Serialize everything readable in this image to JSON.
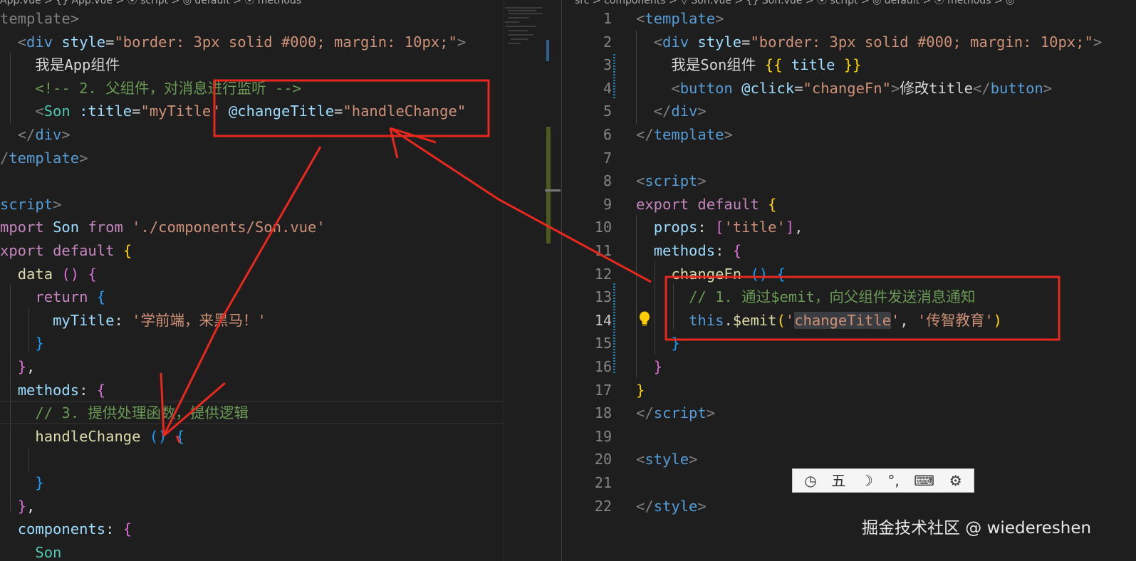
{
  "left_editor": {
    "breadcrumb": "App.vue > {} App.vue > ⦿ script > ◎ default > ⦿ methods",
    "lines": [
      [
        [
          "t-br",
          "template>"
        ]
      ],
      [
        [
          "t-txt",
          "  "
        ],
        [
          "t-br",
          "<"
        ],
        [
          "t-tag",
          "div"
        ],
        [
          "t-txt",
          " "
        ],
        [
          "t-attr",
          "style"
        ],
        [
          "t-txt",
          "="
        ],
        [
          "t-str",
          "\"border: 3px solid #000; margin: 10px;\""
        ],
        [
          "t-br",
          ">"
        ]
      ],
      [
        [
          "t-txt",
          "    我是App组件"
        ]
      ],
      [
        [
          "t-txt",
          "    "
        ],
        [
          "t-com",
          "<!-- 2. 父组件，对消息进行监听 -->"
        ]
      ],
      [
        [
          "t-txt",
          "    "
        ],
        [
          "t-br",
          "<"
        ],
        [
          "t-cls",
          "Son"
        ],
        [
          "t-txt",
          " "
        ],
        [
          "t-attr",
          ":title"
        ],
        [
          "t-txt",
          "="
        ],
        [
          "t-str",
          "\"myTitle\""
        ],
        [
          "t-txt",
          " "
        ],
        [
          "t-attr",
          "@changeTitle"
        ],
        [
          "t-txt",
          "="
        ],
        [
          "t-str",
          "\"handleChange\""
        ]
      ],
      [
        [
          "t-txt",
          "  "
        ],
        [
          "t-br",
          "</"
        ],
        [
          "t-tag",
          "div"
        ],
        [
          "t-br",
          ">"
        ]
      ],
      [
        [
          "t-br",
          "/"
        ],
        [
          "t-tag",
          "template"
        ],
        [
          "t-br",
          ">"
        ]
      ],
      [],
      [
        [
          "t-tag",
          "script"
        ],
        [
          "t-br",
          ">"
        ]
      ],
      [
        [
          "t-kw",
          "mport"
        ],
        [
          "t-txt",
          " "
        ],
        [
          "t-prop",
          "Son"
        ],
        [
          "t-txt",
          " "
        ],
        [
          "t-kw",
          "from"
        ],
        [
          "t-txt",
          " "
        ],
        [
          "t-str",
          "'./components/Son.vue'"
        ]
      ],
      [
        [
          "t-kw",
          "xport"
        ],
        [
          "t-txt",
          " "
        ],
        [
          "t-kw",
          "default"
        ],
        [
          "t-txt",
          " "
        ],
        [
          "t-y",
          "{"
        ]
      ],
      [
        [
          "t-txt",
          "  "
        ],
        [
          "t-fn",
          "data"
        ],
        [
          "t-txt",
          " "
        ],
        [
          "t-p",
          "()"
        ],
        [
          "t-txt",
          " "
        ],
        [
          "t-p",
          "{"
        ]
      ],
      [
        [
          "t-txt",
          "    "
        ],
        [
          "t-kw",
          "return"
        ],
        [
          "t-txt",
          " "
        ],
        [
          "t-b",
          "{"
        ]
      ],
      [
        [
          "t-txt",
          "      "
        ],
        [
          "t-prop",
          "myTitle"
        ],
        [
          "t-txt",
          ": "
        ],
        [
          "t-str",
          "'学前端，来黑马！'"
        ]
      ],
      [
        [
          "t-txt",
          "    "
        ],
        [
          "t-b",
          "}"
        ]
      ],
      [
        [
          "t-txt",
          "  "
        ],
        [
          "t-p",
          "}"
        ],
        [
          "t-txt",
          ","
        ]
      ],
      [
        [
          "t-txt",
          "  "
        ],
        [
          "t-prop",
          "methods"
        ],
        [
          "t-txt",
          ": "
        ],
        [
          "t-p",
          "{"
        ]
      ],
      [
        [
          "t-txt",
          "    "
        ],
        [
          "t-com",
          "// 3. 提供处理函数，提供逻辑"
        ]
      ],
      [
        [
          "t-txt",
          "    "
        ],
        [
          "t-fn",
          "handleChange"
        ],
        [
          "t-txt",
          " "
        ],
        [
          "t-b",
          "()"
        ],
        [
          "t-txt",
          " "
        ],
        [
          "t-b",
          "{"
        ]
      ],
      [],
      [
        [
          "t-txt",
          "    "
        ],
        [
          "t-b",
          "}"
        ]
      ],
      [
        [
          "t-txt",
          "  "
        ],
        [
          "t-p",
          "}"
        ],
        [
          "t-txt",
          ","
        ]
      ],
      [
        [
          "t-txt",
          "  "
        ],
        [
          "t-prop",
          "components"
        ],
        [
          "t-txt",
          ": "
        ],
        [
          "t-p",
          "{"
        ]
      ],
      [
        [
          "t-txt",
          "    "
        ],
        [
          "t-cls",
          "Son"
        ]
      ]
    ]
  },
  "right_editor": {
    "breadcrumb": "src > components > ▽ Son.vue > {} Son.vue > ⦿ script > ◎ default > ⦿ methods > ◎",
    "active_line": "14",
    "line_numbers": [
      "1",
      "2",
      "3",
      "4",
      "5",
      "6",
      "7",
      "8",
      "9",
      "10",
      "11",
      "12",
      "13",
      "14",
      "15",
      "16",
      "17",
      "18",
      "19",
      "20",
      "21",
      "22"
    ],
    "lines": [
      [
        [
          "t-br",
          "<"
        ],
        [
          "t-tag",
          "template"
        ],
        [
          "t-br",
          ">"
        ]
      ],
      [
        [
          "t-txt",
          "  "
        ],
        [
          "t-br",
          "<"
        ],
        [
          "t-tag",
          "div"
        ],
        [
          "t-txt",
          " "
        ],
        [
          "t-attr",
          "style"
        ],
        [
          "t-txt",
          "="
        ],
        [
          "t-str",
          "\"border: 3px solid #000; margin: 10px;\""
        ],
        [
          "t-br",
          ">"
        ]
      ],
      [
        [
          "t-txt",
          "    我是Son组件 "
        ],
        [
          "t-y",
          "{{"
        ],
        [
          "t-txt",
          " "
        ],
        [
          "t-prop",
          "title"
        ],
        [
          "t-txt",
          " "
        ],
        [
          "t-y",
          "}}"
        ]
      ],
      [
        [
          "t-txt",
          "    "
        ],
        [
          "t-br",
          "<"
        ],
        [
          "t-tag",
          "button"
        ],
        [
          "t-txt",
          " "
        ],
        [
          "t-attr",
          "@click"
        ],
        [
          "t-txt",
          "="
        ],
        [
          "t-str",
          "\"changeFn\""
        ],
        [
          "t-br",
          ">"
        ],
        [
          "t-txt",
          "修改title"
        ],
        [
          "t-br",
          "</"
        ],
        [
          "t-tag",
          "button"
        ],
        [
          "t-br",
          ">"
        ]
      ],
      [
        [
          "t-txt",
          "  "
        ],
        [
          "t-br",
          "</"
        ],
        [
          "t-tag",
          "div"
        ],
        [
          "t-br",
          ">"
        ]
      ],
      [
        [
          "t-br",
          "</"
        ],
        [
          "t-tag",
          "template"
        ],
        [
          "t-br",
          ">"
        ]
      ],
      [],
      [
        [
          "t-br",
          "<"
        ],
        [
          "t-tag",
          "script"
        ],
        [
          "t-br",
          ">"
        ]
      ],
      [
        [
          "t-kw",
          "export"
        ],
        [
          "t-txt",
          " "
        ],
        [
          "t-kw",
          "default"
        ],
        [
          "t-txt",
          " "
        ],
        [
          "t-y",
          "{"
        ]
      ],
      [
        [
          "t-txt",
          "  "
        ],
        [
          "t-prop",
          "props"
        ],
        [
          "t-txt",
          ": "
        ],
        [
          "t-p",
          "["
        ],
        [
          "t-str",
          "'title'"
        ],
        [
          "t-p",
          "]"
        ],
        [
          "t-txt",
          ","
        ]
      ],
      [
        [
          "t-txt",
          "  "
        ],
        [
          "t-prop",
          "methods"
        ],
        [
          "t-txt",
          ": "
        ],
        [
          "t-p",
          "{"
        ]
      ],
      [
        [
          "t-txt",
          "    "
        ],
        [
          "t-fn",
          "changeFn"
        ],
        [
          "t-txt",
          " "
        ],
        [
          "t-b",
          "()"
        ],
        [
          "t-txt",
          " "
        ],
        [
          "t-b",
          "{"
        ]
      ],
      [
        [
          "t-txt",
          "      "
        ],
        [
          "t-com",
          "// 1. 通过$emit，向父组件发送消息通知"
        ]
      ],
      [
        [
          "t-txt",
          "      "
        ],
        [
          "t-kw2",
          "this"
        ],
        [
          "t-txt",
          "."
        ],
        [
          "t-fn",
          "$emit"
        ],
        [
          "t-y",
          "("
        ],
        [
          "t-str",
          "'"
        ],
        [
          "t-str sel-bg",
          "changeTitle"
        ],
        [
          "t-str",
          "'"
        ],
        [
          "t-txt",
          ", "
        ],
        [
          "t-str",
          "'传智教育'"
        ],
        [
          "t-y",
          ")"
        ]
      ],
      [
        [
          "t-txt",
          "    "
        ],
        [
          "t-b",
          "}"
        ]
      ],
      [
        [
          "t-txt",
          "  "
        ],
        [
          "t-p",
          "}"
        ]
      ],
      [
        [
          "t-y",
          "}"
        ]
      ],
      [
        [
          "t-br",
          "</"
        ],
        [
          "t-tag",
          "script"
        ],
        [
          "t-br",
          ">"
        ]
      ],
      [],
      [
        [
          "t-br",
          "<"
        ],
        [
          "t-tag",
          "style"
        ],
        [
          "t-br",
          ">"
        ]
      ],
      [],
      [
        [
          "t-br",
          "</"
        ],
        [
          "t-tag",
          "style"
        ],
        [
          "t-br",
          ">"
        ]
      ]
    ]
  },
  "ime_toolbar": {
    "items": [
      {
        "icon": "speed-icon",
        "text": "◷"
      },
      {
        "icon": "wubi-icon",
        "text": "五"
      },
      {
        "icon": "moon-icon",
        "text": "☽"
      },
      {
        "icon": "punctuation-icon",
        "text": "°,"
      },
      {
        "icon": "keyboard-icon",
        "text": "⌨"
      },
      {
        "icon": "gear-icon",
        "text": "⚙"
      }
    ]
  },
  "watermark": "掘金技术社区 @ wiedereshen",
  "colors": {
    "annotation_red": "#e8281e",
    "editor_bg": "#1e1e1e"
  }
}
